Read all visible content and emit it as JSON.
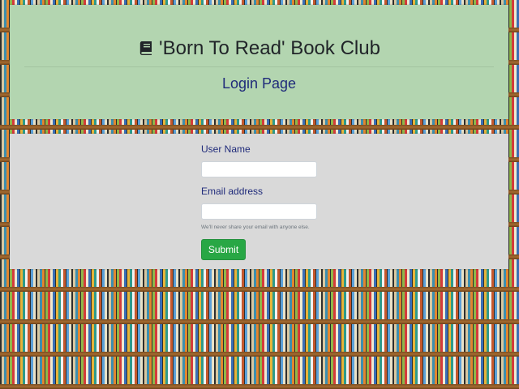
{
  "header": {
    "icon": "book-icon",
    "title": "'Born To Read' Book Club",
    "subtitle": "Login Page",
    "background_color": "#b3d5b0"
  },
  "form": {
    "username_label": "User Name",
    "username_value": "",
    "email_label": "Email address",
    "email_value": "",
    "email_help": "We'll never share your email with anyone else.",
    "submit_label": "Submit",
    "submit_color": "#28a745",
    "panel_color": "#d9d9d9"
  }
}
